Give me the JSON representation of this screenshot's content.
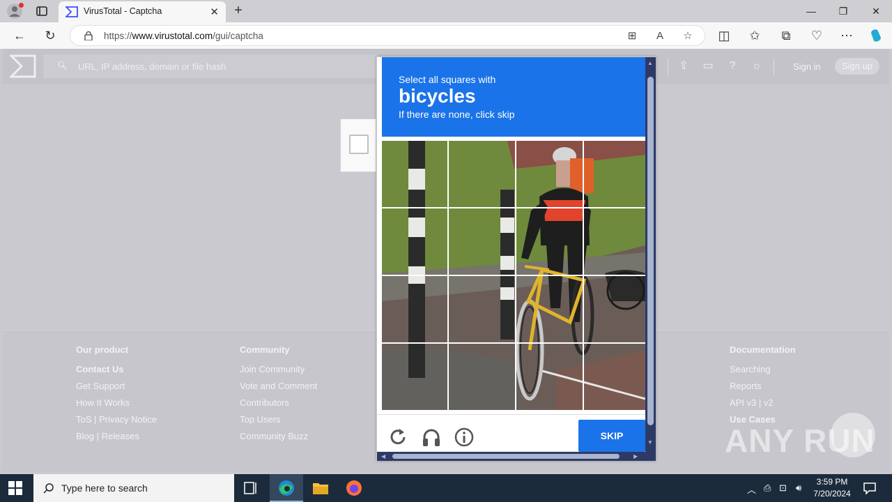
{
  "browser": {
    "tab_title": "VirusTotal - Captcha",
    "url_prefix": "https://",
    "url_domain": "www.virustotal.com",
    "url_path": "/gui/captcha"
  },
  "vt": {
    "search_placeholder": "URL, IP address, domain or file hash",
    "sign_in": "Sign in",
    "sign_up": "Sign up"
  },
  "footer": {
    "columns": [
      {
        "heading": "Our product",
        "links": [
          "Contact Us",
          "Get Support",
          "How It Works",
          "ToS | Privacy Notice",
          "Blog | Releases"
        ]
      },
      {
        "heading": "Community",
        "links": [
          "Join Community",
          "Vote and Comment",
          "Contributors",
          "Top Users",
          "Community Buzz"
        ]
      },
      {
        "heading": "Documentation",
        "links": [
          "Searching",
          "Reports",
          "API v3 | v2",
          "Use Cases"
        ]
      }
    ]
  },
  "captcha": {
    "line1": "Select all squares with",
    "target": "bicycles",
    "line3": "If there are none, click skip",
    "skip": "SKIP",
    "grid": "4x4",
    "icons": [
      "reload-icon",
      "audio-icon",
      "info-icon"
    ]
  },
  "watermark": "ANY RUN",
  "taskbar": {
    "search_placeholder": "Type here to search",
    "time": "3:59 PM",
    "date": "7/20/2024"
  },
  "colors": {
    "captcha_blue": "#1a73e8",
    "taskbar": "#1c2b3c"
  }
}
